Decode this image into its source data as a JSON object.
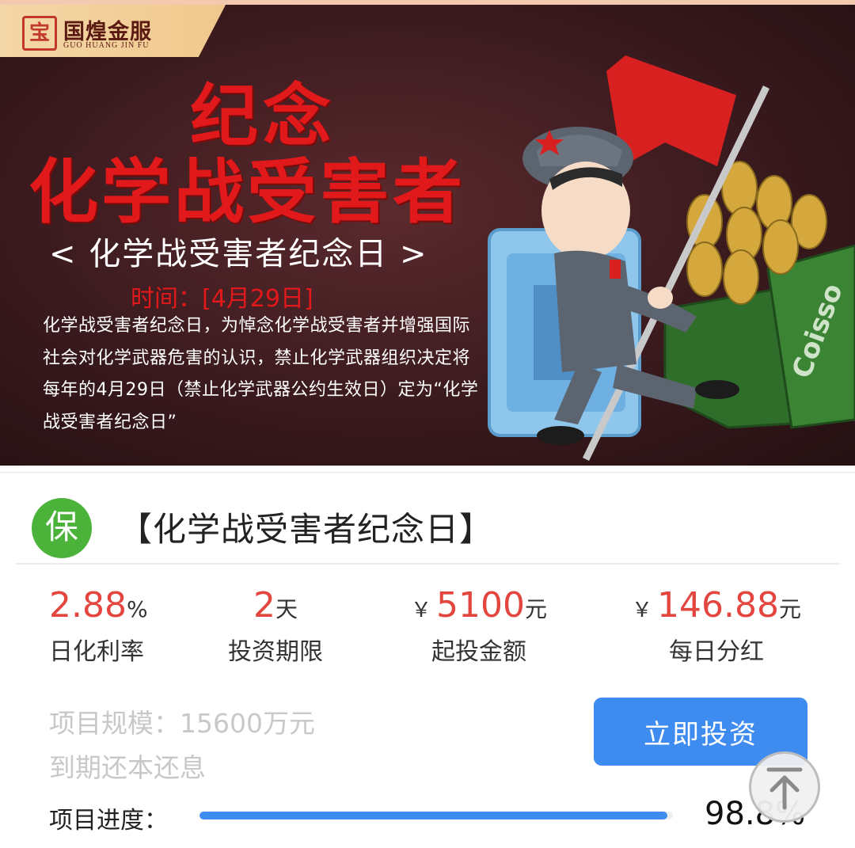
{
  "banner": {
    "brand_cn": "国煌金服",
    "brand_en": "GUO HUANG JIN FU",
    "brand_mark": "宝",
    "title_line1": "纪念",
    "title_line2": "化学战受害者",
    "subtitle": "< 化学战受害者纪念日 >",
    "time_label": "时间：",
    "time_value": "[4月29日]",
    "description": "化学战受害者纪念日，为悼念化学战受害者并增强国际社会对化学武器危害的认识，禁止化学武器组织决定将每年的4月29日（禁止化学武器公约生效日）定为“化学战受害者纪念日”",
    "box_text": "Coisso",
    "colors": {
      "title_red": "#e2191b",
      "background": "#3a1a1e"
    }
  },
  "card": {
    "badge": "保",
    "badge_color": "#4cb33a",
    "title": "【化学战受害者纪念日】",
    "stats": [
      {
        "value": "2.88",
        "unit": "%",
        "label": "日化利率"
      },
      {
        "value": "2",
        "unit": "天",
        "label": "投资期限"
      },
      {
        "prefix": "￥",
        "value": "5100",
        "unit": "元",
        "label": "起投金额"
      },
      {
        "prefix": "￥",
        "value": "146.88",
        "unit": "元",
        "label": "每日分红"
      }
    ],
    "scale": "项目规模：15600万元",
    "repayment": "到期还本还息",
    "invest_button": "立即投资",
    "progress_label": "项目进度：",
    "progress_value": "98.8%",
    "progress_fraction": 0.988,
    "accent_color": "#3f8cf0",
    "value_color": "#e2463e"
  },
  "icons": {
    "back_to_top": "arrow-up-icon"
  }
}
